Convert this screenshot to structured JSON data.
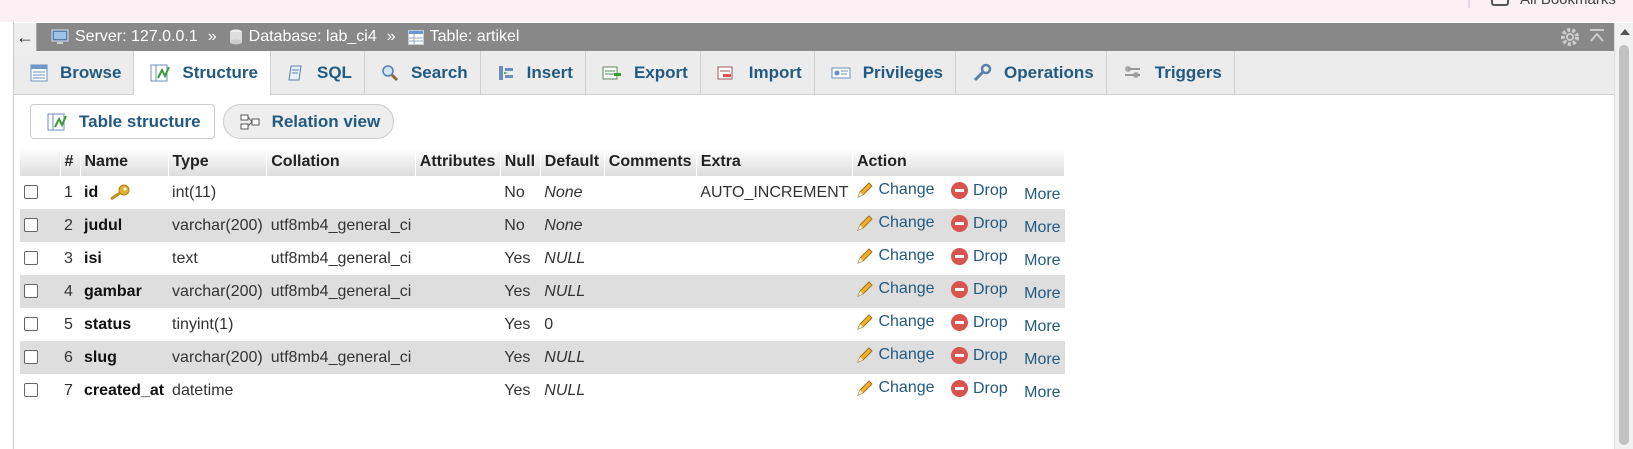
{
  "bookmarks": {
    "label": "All Bookmarks"
  },
  "breadcrumb": {
    "server": "Server: 127.0.0.1",
    "database": "Database: lab_ci4",
    "table": "Table: artikel",
    "sep": "»"
  },
  "tabs": [
    {
      "label": "Browse",
      "icon": "browse-icon"
    },
    {
      "label": "Structure",
      "icon": "structure-icon",
      "active": true
    },
    {
      "label": "SQL",
      "icon": "sql-icon"
    },
    {
      "label": "Search",
      "icon": "search-icon"
    },
    {
      "label": "Insert",
      "icon": "insert-icon"
    },
    {
      "label": "Export",
      "icon": "export-icon"
    },
    {
      "label": "Import",
      "icon": "import-icon"
    },
    {
      "label": "Privileges",
      "icon": "privileges-icon"
    },
    {
      "label": "Operations",
      "icon": "wrench-icon"
    },
    {
      "label": "Triggers",
      "icon": "triggers-icon"
    }
  ],
  "subtabs": {
    "table_structure": "Table structure",
    "relation_view": "Relation view"
  },
  "table": {
    "headers": [
      "#",
      "Name",
      "Type",
      "Collation",
      "Attributes",
      "Null",
      "Default",
      "Comments",
      "Extra",
      "Action"
    ],
    "rows": [
      {
        "num": "1",
        "name": "id",
        "type": "int(11)",
        "collation": "",
        "attributes": "",
        "null": "No",
        "default": "None",
        "comments": "",
        "extra": "AUTO_INCREMENT",
        "primary": true
      },
      {
        "num": "2",
        "name": "judul",
        "type": "varchar(200)",
        "collation": "utf8mb4_general_ci",
        "attributes": "",
        "null": "No",
        "default": "None",
        "comments": "",
        "extra": ""
      },
      {
        "num": "3",
        "name": "isi",
        "type": "text",
        "collation": "utf8mb4_general_ci",
        "attributes": "",
        "null": "Yes",
        "default": "NULL",
        "comments": "",
        "extra": ""
      },
      {
        "num": "4",
        "name": "gambar",
        "type": "varchar(200)",
        "collation": "utf8mb4_general_ci",
        "attributes": "",
        "null": "Yes",
        "default": "NULL",
        "comments": "",
        "extra": ""
      },
      {
        "num": "5",
        "name": "status",
        "type": "tinyint(1)",
        "collation": "",
        "attributes": "",
        "null": "Yes",
        "default": "0",
        "comments": "",
        "extra": ""
      },
      {
        "num": "6",
        "name": "slug",
        "type": "varchar(200)",
        "collation": "utf8mb4_general_ci",
        "attributes": "",
        "null": "Yes",
        "default": "NULL",
        "comments": "",
        "extra": ""
      },
      {
        "num": "7",
        "name": "created_at",
        "type": "datetime",
        "collation": "",
        "attributes": "",
        "null": "Yes",
        "default": "NULL",
        "comments": "",
        "extra": ""
      }
    ],
    "actions": {
      "change": "Change",
      "drop": "Drop",
      "more": "More"
    }
  },
  "colors": {
    "link": "#235a81",
    "crumbbar": "#888888",
    "drop": "#d9534f"
  }
}
